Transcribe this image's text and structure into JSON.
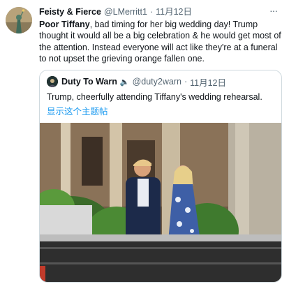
{
  "author": {
    "name": "Feisty & Fierce",
    "handle": "@LMerritt1",
    "separator": "·",
    "date": "11月12日",
    "more_label": "···"
  },
  "tweet": {
    "bold_lead": "Poor Tiffany",
    "text": ", bad timing for her big wedding day! Trump thought it would all be a big celebration & he would get most of the attention. Instead everyone will act like they're at a funeral to not upset the grieving orange fallen one."
  },
  "quoted": {
    "name": "Duty To Warn",
    "emoji": "🔈",
    "handle": "@duty2warn",
    "separator": "·",
    "date": "11月12日",
    "text": "Trump, cheerfully attending Tiffany's wedding rehearsal.",
    "show_thread": "显示这个主题帖"
  },
  "colors": {
    "text": "#0f1419",
    "secondary": "#536471",
    "link": "#1d9bf0",
    "border": "#cfd9de"
  },
  "icons": {
    "more": "more-dots-icon",
    "speaker": "speaker-emoji"
  }
}
